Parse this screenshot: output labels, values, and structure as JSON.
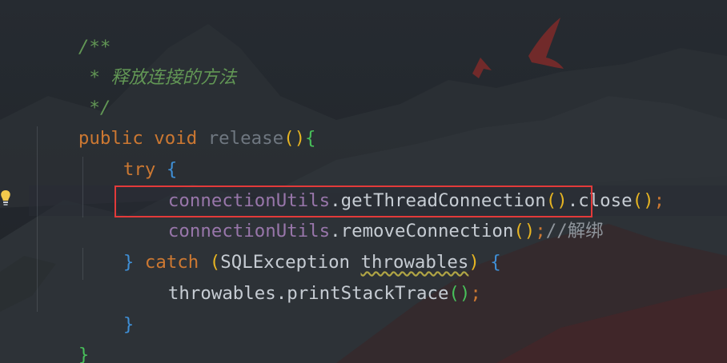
{
  "editor": {
    "lines": [
      {
        "segments": [
          "/**"
        ]
      },
      {
        "segments": [
          " * 释放连接的方法"
        ]
      },
      {
        "segments": [
          " */"
        ]
      },
      {
        "segments": [
          "public",
          " ",
          "void",
          " ",
          "release",
          "(",
          ")",
          "{"
        ]
      },
      {
        "segments": [
          "try",
          " ",
          "{"
        ]
      },
      {
        "segments": [
          "connectionUtils",
          ".getThreadConnection",
          "(",
          ")",
          ".close",
          "(",
          ")",
          ";"
        ]
      },
      {
        "segments": [
          "connectionUtils",
          ".removeConnection",
          "(",
          ")",
          ";",
          "//解绑"
        ]
      },
      {
        "segments": [
          "}",
          " ",
          "catch",
          " ",
          "(",
          "SQLException",
          " ",
          "throwables",
          ")",
          " ",
          "{"
        ]
      },
      {
        "segments": [
          "throwables",
          ".printStackTrace",
          "(",
          ")",
          ";"
        ]
      },
      {
        "segments": [
          "}"
        ]
      },
      {
        "segments": [
          "}"
        ]
      }
    ]
  },
  "colors": {
    "comment": "#629755",
    "keyword": "#cc7832",
    "field": "#9876aa",
    "plain": "#c6ccd3",
    "highlight_border": "#e33a3a",
    "background": "#23272c"
  },
  "icons": {
    "gutter": "lightbulb-icon"
  }
}
